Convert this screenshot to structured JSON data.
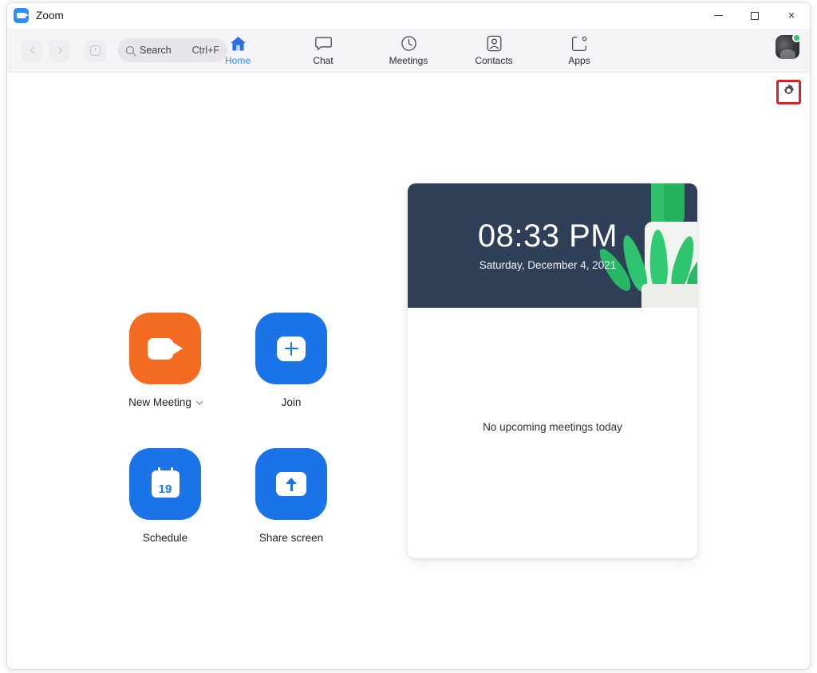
{
  "window": {
    "title": "Zoom",
    "logo_icon": "zoom-camera-logo",
    "controls": {
      "minimize": {
        "label": "−",
        "icon": "minimize-icon"
      },
      "maximize": {
        "label": "□",
        "icon": "maximize-icon"
      },
      "close": {
        "label": "×",
        "icon": "close-icon"
      }
    }
  },
  "toolbar": {
    "nav": [
      {
        "name": "back-button",
        "icon": "chevron-left-icon",
        "disabled": true
      },
      {
        "name": "forward-button",
        "icon": "chevron-right-icon",
        "disabled": true
      },
      {
        "name": "history-button",
        "icon": "history-clock-icon",
        "disabled": true
      }
    ],
    "search": {
      "placeholder": "Search",
      "shortcut": "Ctrl+F",
      "icon": "search-icon"
    },
    "tabs": [
      {
        "label": "Home",
        "icon": "home-icon",
        "active": true
      },
      {
        "label": "Chat",
        "icon": "chat-bubble-icon",
        "active": false
      },
      {
        "label": "Meetings",
        "icon": "clock-icon",
        "active": false
      },
      {
        "label": "Contacts",
        "icon": "person-card-icon",
        "active": false
      },
      {
        "label": "Apps",
        "icon": "apps-grid-icon",
        "active": false
      }
    ],
    "avatar": {
      "name": "user-avatar",
      "status": "available",
      "status_color": "#2dc26b"
    }
  },
  "content": {
    "settings_button": {
      "icon": "gear-icon",
      "highlight_color": "#e02020",
      "highlighted": true
    },
    "actions": [
      {
        "label": "New Meeting",
        "icon": "video-camera-icon",
        "color": "#f26b21",
        "has_dropdown": true,
        "dropdown_icon": "chevron-down-icon"
      },
      {
        "label": "Join",
        "icon": "plus-icon",
        "color": "#1a74e8",
        "has_dropdown": false
      },
      {
        "label": "Schedule",
        "icon": "calendar-icon",
        "icon_day": "19",
        "color": "#1a74e8",
        "has_dropdown": false
      },
      {
        "label": "Share screen",
        "icon": "arrow-up-icon",
        "color": "#1a74e8",
        "has_dropdown": false
      }
    ],
    "meetings_card": {
      "time": "08:33 PM",
      "date": "Saturday, December 4, 2021",
      "banner_color": "#2f3f58",
      "illustration": "potted-plant-illustration",
      "empty_text": "No upcoming meetings today"
    }
  }
}
